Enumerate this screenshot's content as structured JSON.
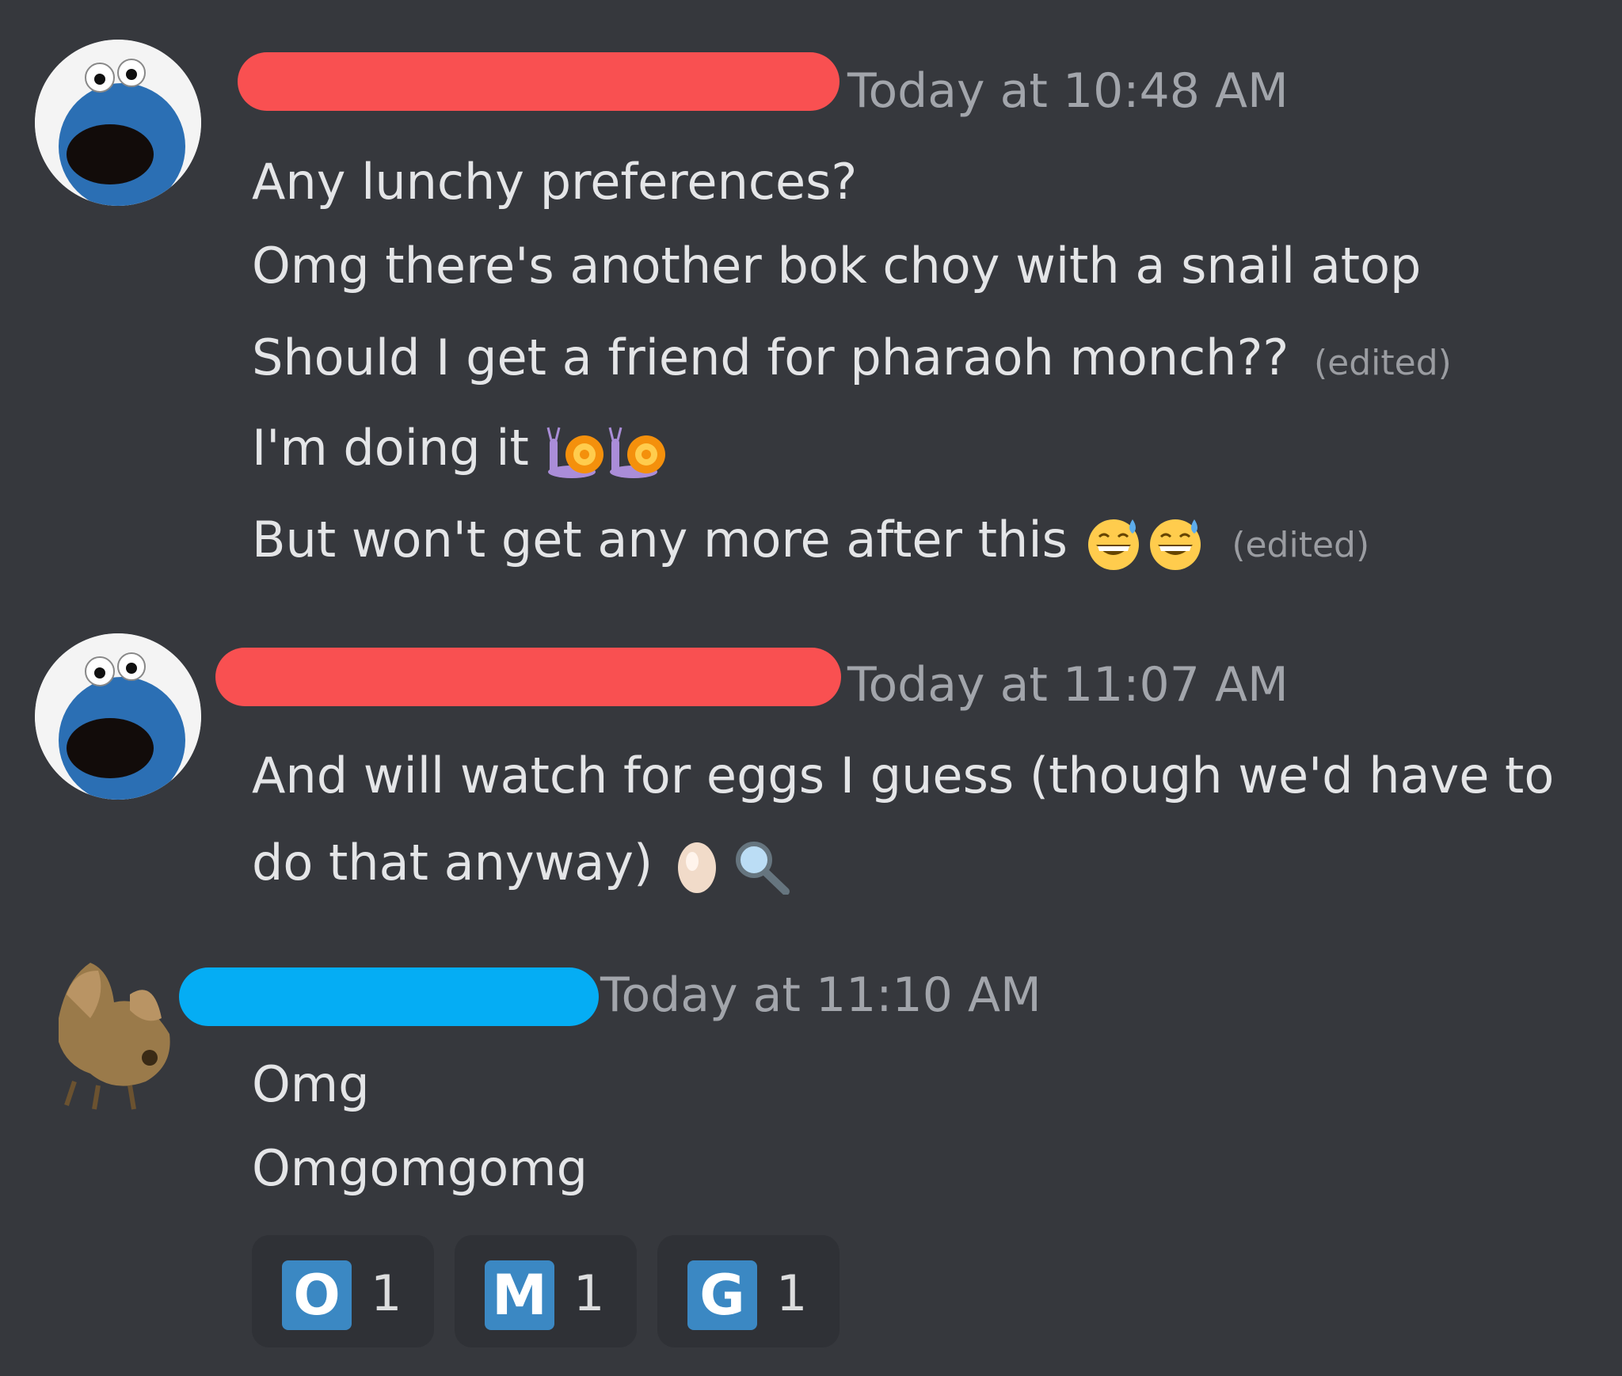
{
  "messages": [
    {
      "author_redaction_color": "#f95051",
      "timestamp": "Today at 10:48 AM",
      "lines": [
        {
          "text": "Any lunchy preferences?"
        },
        {
          "text": "Omg there's another bok choy with a snail atop"
        },
        {
          "text": "Should I get a friend for pharaoh monch??",
          "edited": "(edited)"
        },
        {
          "text": "I'm doing it",
          "emoji": [
            "snail-emoji",
            "snail-emoji"
          ]
        },
        {
          "text": "But won't get any more after this",
          "emoji": [
            "grinning-sweat-emoji",
            "grinning-sweat-emoji"
          ],
          "edited": "(edited)"
        }
      ]
    },
    {
      "author_redaction_color": "#f95051",
      "timestamp": "Today at 11:07 AM",
      "lines": [
        {
          "text": "And will watch for eggs I guess (though we'd have to"
        },
        {
          "text": "do that anyway)",
          "emoji": [
            "egg-emoji",
            "magnifying-glass-emoji"
          ]
        }
      ]
    },
    {
      "author_redaction_color": "#05adf4",
      "timestamp": "Today at 11:10 AM",
      "lines": [
        {
          "text": "Omg"
        },
        {
          "text": "Omgomgomg"
        }
      ],
      "reactions": [
        {
          "letter": "O",
          "count": "1"
        },
        {
          "letter": "M",
          "count": "1"
        },
        {
          "letter": "G",
          "count": "1"
        }
      ]
    }
  ]
}
